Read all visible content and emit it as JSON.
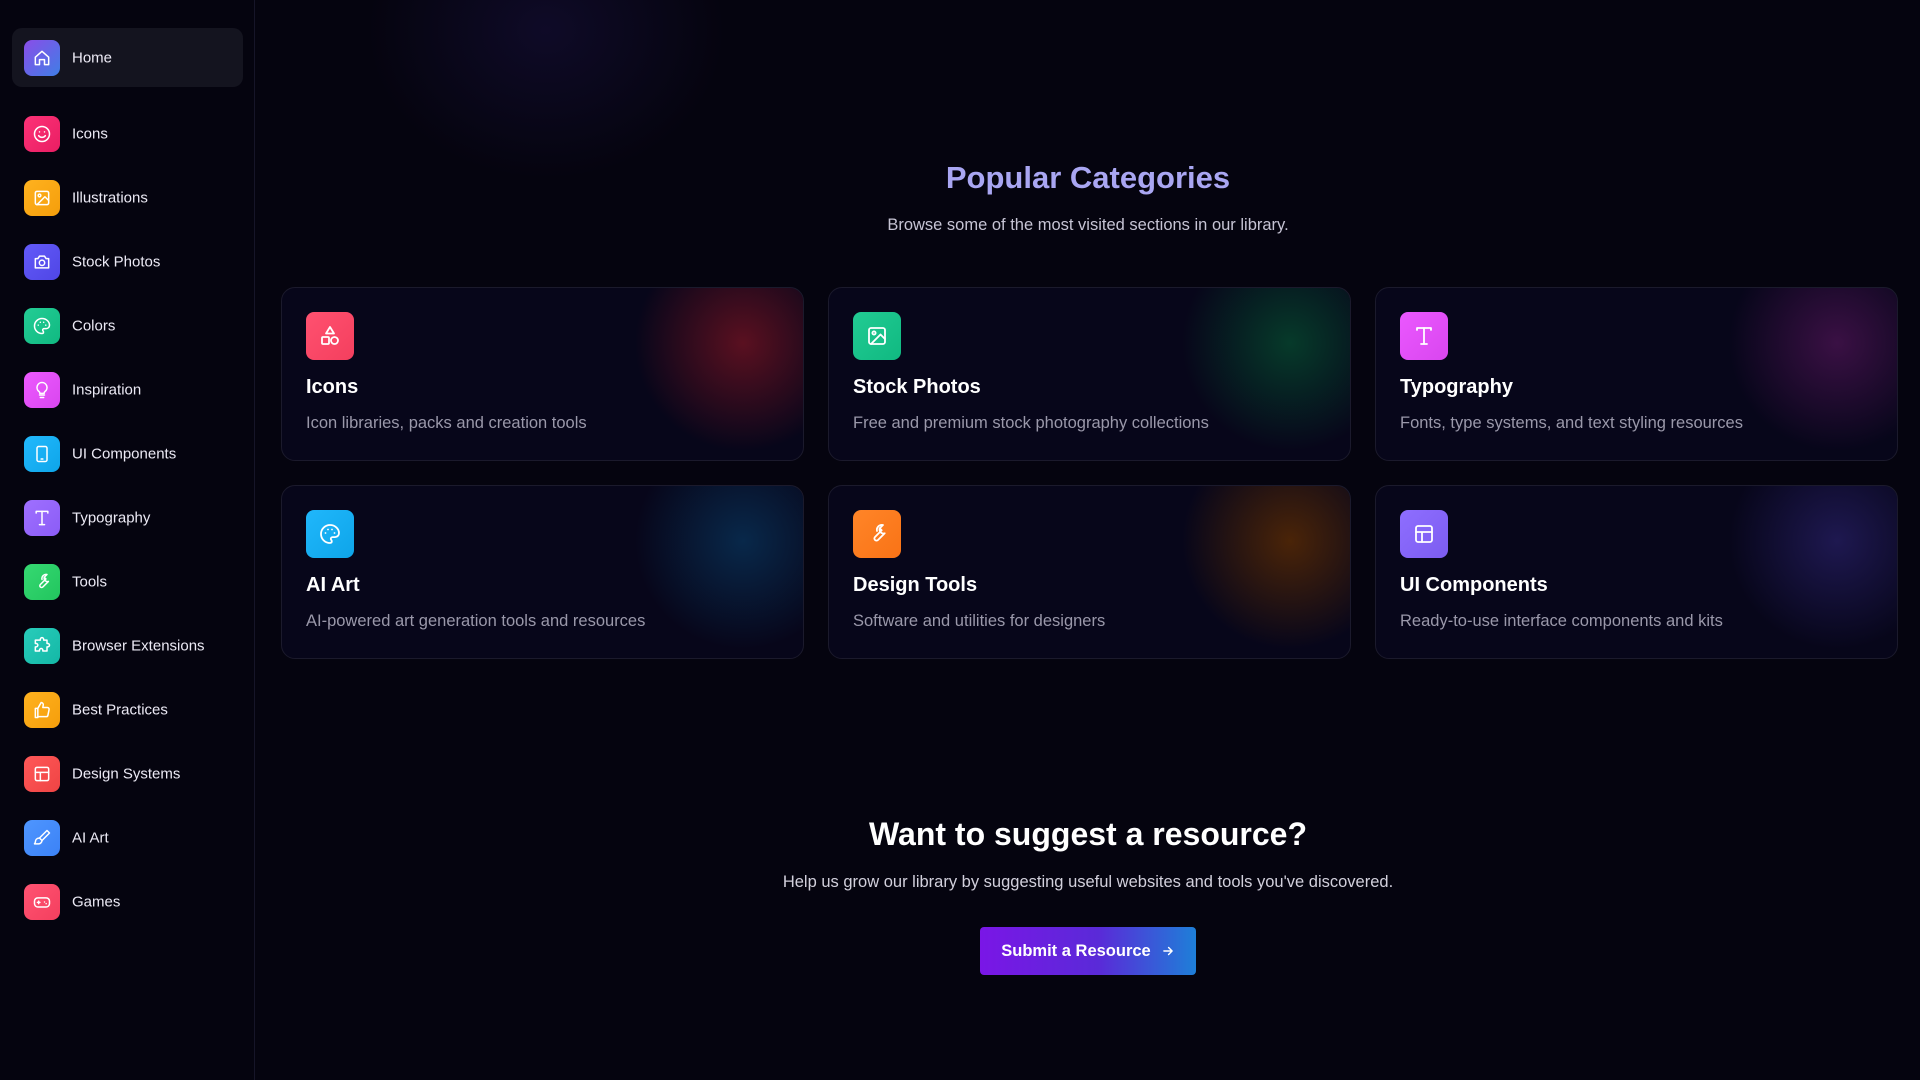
{
  "sidebar": {
    "items": [
      {
        "label": "Home",
        "icon": "home-icon",
        "color": "#6d5ae0",
        "active": true
      },
      {
        "label": "Icons",
        "icon": "smile-icon",
        "color": "#e91e63"
      },
      {
        "label": "Illustrations",
        "icon": "image-icon",
        "color": "#f59e0b"
      },
      {
        "label": "Stock Photos",
        "icon": "camera-icon",
        "color": "#4f46e5"
      },
      {
        "label": "Colors",
        "icon": "palette-icon",
        "color": "#10b981"
      },
      {
        "label": "Inspiration",
        "icon": "lightbulb-icon",
        "color": "#d946ef"
      },
      {
        "label": "UI Components",
        "icon": "tablet-icon",
        "color": "#0ea5e9"
      },
      {
        "label": "Typography",
        "icon": "type-icon",
        "color": "#8b5cf6"
      },
      {
        "label": "Tools",
        "icon": "wrench-icon",
        "color": "#22c55e"
      },
      {
        "label": "Browser Extensions",
        "icon": "puzzle-icon",
        "color": "#14b8a6"
      },
      {
        "label": "Best Practices",
        "icon": "thumbs-up-icon",
        "color": "#f59e0b"
      },
      {
        "label": "Design Systems",
        "icon": "layout-icon",
        "color": "#ef4444"
      },
      {
        "label": "AI Art",
        "icon": "brush-icon",
        "color": "#3b82f6"
      },
      {
        "label": "Games",
        "icon": "gamepad-icon",
        "color": "#f43f5e"
      }
    ]
  },
  "categories": {
    "title": "Popular Categories",
    "subtitle": "Browse some of the most visited sections in our library.",
    "cards": [
      {
        "title": "Icons",
        "description": "Icon libraries, packs and creation tools",
        "icon": "shapes-icon",
        "color": "#f43f5e",
        "glow": "#5a1020"
      },
      {
        "title": "Stock Photos",
        "description": "Free and premium stock photography collections",
        "icon": "image-icon",
        "color": "#10b981",
        "glow": "#063a2a"
      },
      {
        "title": "Typography",
        "description": "Fonts, type systems, and text styling resources",
        "icon": "type-icon",
        "color": "#d946ef",
        "glow": "#3a1044"
      },
      {
        "title": "AI Art",
        "description": "AI-powered art generation tools and resources",
        "icon": "palette-icon",
        "color": "#0ea5e9",
        "glow": "#08284a"
      },
      {
        "title": "Design Tools",
        "description": "Software and utilities for designers",
        "icon": "wrench-icon",
        "color": "#f97316",
        "glow": "#4a2408"
      },
      {
        "title": "UI Components",
        "description": "Ready-to-use interface components and kits",
        "icon": "layout-icon",
        "color": "#7c5cf0",
        "glow": "#1e1850"
      }
    ]
  },
  "cta": {
    "title": "Want to suggest a resource?",
    "subtitle": "Help us grow our library by suggesting useful websites and tools you've discovered.",
    "button_label": "Submit a Resource"
  }
}
